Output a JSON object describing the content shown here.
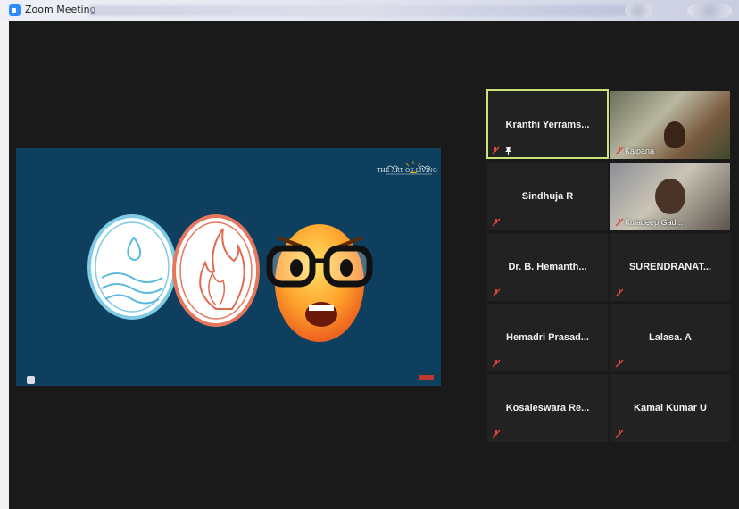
{
  "window": {
    "title": "Zoom Meeting"
  },
  "share": {
    "brand_text": "THE ART OF LIVING"
  },
  "participants": [
    {
      "name": "Kranthi  Yerrams...",
      "video": false,
      "active_speaker": true
    },
    {
      "name": "Kalpana",
      "video": true
    },
    {
      "name": "Sindhuja R",
      "video": false
    },
    {
      "name": "Kuladeep Gad...",
      "video": true
    },
    {
      "name": "Dr. B. Hemanth...",
      "video": false
    },
    {
      "name": "SURENDRANAT...",
      "video": false
    },
    {
      "name": "Hemadri  Prasad...",
      "video": false
    },
    {
      "name": "Lalasa. A",
      "video": false
    },
    {
      "name": "Kosaleswara  Re...",
      "video": false
    },
    {
      "name": "Kamal Kumar U",
      "video": false
    }
  ],
  "colors": {
    "accent_active": "#c9e27a",
    "mic_off": "#e0463a",
    "share_bg": "#0f3f5e"
  }
}
